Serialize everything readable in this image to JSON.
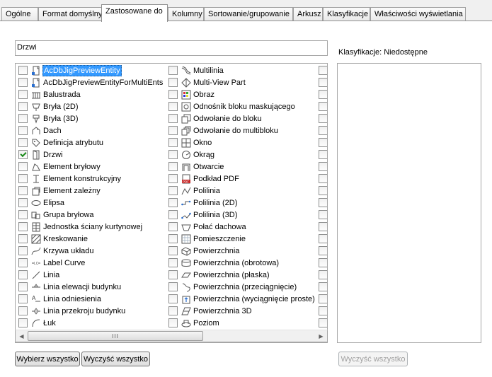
{
  "tabs": [
    {
      "label": "Ogólne"
    },
    {
      "label": "Format domyślny"
    },
    {
      "label": "Zastosowane do"
    },
    {
      "label": "Kolumny"
    },
    {
      "label": "Sortowanie/grupowanie"
    },
    {
      "label": "Arkusz"
    },
    {
      "label": "Klasyfikacje"
    },
    {
      "label": "Właściwości wyświetlania"
    }
  ],
  "filter": {
    "value": "Drzwi"
  },
  "classification_label": "Klasyfikacje: Niedostępne",
  "list": {
    "col1": [
      {
        "label": "AcDbJigPreviewEntity",
        "icon": "document-icon",
        "checked": false,
        "selected": true
      },
      {
        "label": "AcDbJigPreviewEntityForMultiEnts",
        "icon": "document-icon",
        "checked": false
      },
      {
        "label": "Balustrada",
        "icon": "railing-icon",
        "checked": false
      },
      {
        "label": "Bryła (2D)",
        "icon": "mass-2d-icon",
        "checked": false
      },
      {
        "label": "Bryła (3D)",
        "icon": "mass-3d-icon",
        "checked": false
      },
      {
        "label": "Dach",
        "icon": "roof-icon",
        "checked": false
      },
      {
        "label": "Definicja atrybutu",
        "icon": "tag-icon",
        "checked": false
      },
      {
        "label": "Drzwi",
        "icon": "door-icon",
        "checked": true
      },
      {
        "label": "Element bryłowy",
        "icon": "mass-element-icon",
        "checked": false
      },
      {
        "label": "Element konstrukcyjny",
        "icon": "structural-member-icon",
        "checked": false
      },
      {
        "label": "Element zależny",
        "icon": "dependent-element-icon",
        "checked": false
      },
      {
        "label": "Elipsa",
        "icon": "ellipse-icon",
        "checked": false
      },
      {
        "label": "Grupa bryłowa",
        "icon": "mass-group-icon",
        "checked": false
      },
      {
        "label": "Jednostka ściany kurtynowej",
        "icon": "curtain-wall-unit-icon",
        "checked": false
      },
      {
        "label": "Kreskowanie",
        "icon": "hatch-icon",
        "checked": false
      },
      {
        "label": "Krzywa układu",
        "icon": "layout-curve-icon",
        "checked": false
      },
      {
        "label": "Label Curve",
        "icon": "label-curve-icon",
        "checked": false
      },
      {
        "label": "Linia",
        "icon": "line-icon",
        "checked": false
      },
      {
        "label": "Linia elewacji budynku",
        "icon": "elevation-line-icon",
        "checked": false
      },
      {
        "label": "Linia odniesienia",
        "icon": "leader-icon",
        "checked": false
      },
      {
        "label": "Linia przekroju budynku",
        "icon": "section-line-icon",
        "checked": false
      },
      {
        "label": "Łuk",
        "icon": "arc-icon",
        "checked": false
      }
    ],
    "col2": [
      {
        "label": "Multilinia",
        "icon": "multiline-icon",
        "checked": false
      },
      {
        "label": "Multi-View Part",
        "icon": "multi-view-part-icon",
        "checked": false
      },
      {
        "label": "Obraz",
        "icon": "image-icon",
        "checked": false
      },
      {
        "label": "Odnośnik bloku maskującego",
        "icon": "mask-block-icon",
        "checked": false
      },
      {
        "label": "Odwołanie do bloku",
        "icon": "block-reference-icon",
        "checked": false
      },
      {
        "label": "Odwołanie do multibloku",
        "icon": "multiblock-reference-icon",
        "checked": false
      },
      {
        "label": "Okno",
        "icon": "window-icon",
        "checked": false
      },
      {
        "label": "Okrąg",
        "icon": "circle-icon",
        "checked": false
      },
      {
        "label": "Otwarcie",
        "icon": "opening-icon",
        "checked": false
      },
      {
        "label": "Podkład PDF",
        "icon": "pdf-icon",
        "checked": false
      },
      {
        "label": "Polilinia",
        "icon": "polyline-icon",
        "checked": false
      },
      {
        "label": "Polilinia (2D)",
        "icon": "polyline-2d-icon",
        "checked": false
      },
      {
        "label": "Polilinia (3D)",
        "icon": "polyline-3d-icon",
        "checked": false
      },
      {
        "label": "Połać dachowa",
        "icon": "roof-slab-icon",
        "checked": false
      },
      {
        "label": "Pomieszczenie",
        "icon": "space-icon",
        "checked": false
      },
      {
        "label": "Powierzchnia",
        "icon": "surface-icon",
        "checked": false
      },
      {
        "label": "Powierzchnia (obrotowa)",
        "icon": "revolved-surface-icon",
        "checked": false
      },
      {
        "label": "Powierzchnia (płaska)",
        "icon": "planar-surface-icon",
        "checked": false
      },
      {
        "label": "Powierzchnia (przeciągnięcie)",
        "icon": "swept-surface-icon",
        "checked": false
      },
      {
        "label": "Powierzchnia (wyciągnięcie proste)",
        "icon": "extruded-surface-icon",
        "checked": false
      },
      {
        "label": "Powierzchnia 3D",
        "icon": "surface-3d-icon",
        "checked": false
      },
      {
        "label": "Poziom",
        "icon": "level-icon",
        "checked": false
      }
    ],
    "col3_count": 22
  },
  "buttons": {
    "select_all": "Wybierz wszystko",
    "clear_all": "Wyczyść wszystko",
    "clear_classifications": "Wyczyść wszystko"
  },
  "scrollbar": {
    "grip": "III",
    "left_arrow": "◀",
    "right_arrow": "▶"
  }
}
